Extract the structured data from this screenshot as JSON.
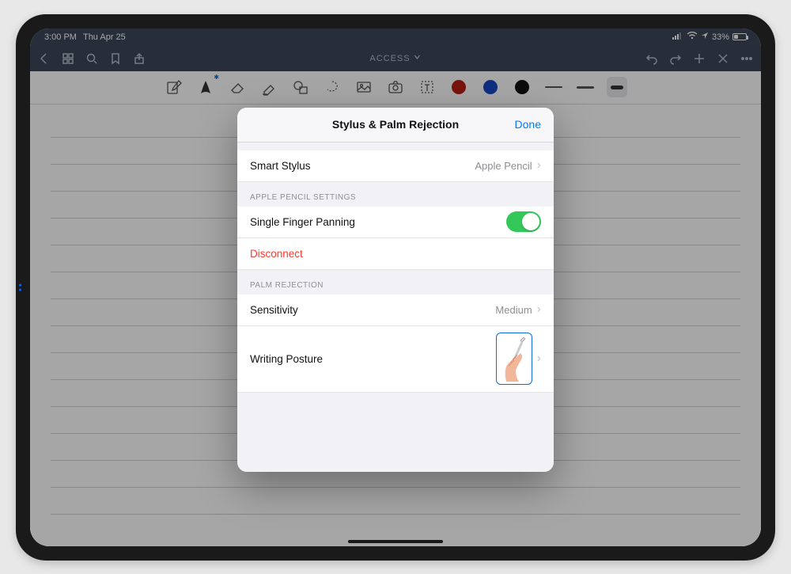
{
  "status": {
    "time": "3:00 PM",
    "date": "Thu Apr 25",
    "battery": "33%"
  },
  "nav": {
    "title": "ACCESS"
  },
  "modal": {
    "title": "Stylus & Palm Rejection",
    "done": "Done",
    "smart_stylus": {
      "label": "Smart Stylus",
      "value": "Apple Pencil"
    },
    "section_apple_pencil": "Apple Pencil Settings",
    "single_finger": "Single Finger Panning",
    "disconnect": "Disconnect",
    "section_palm": "Palm Rejection",
    "sensitivity": {
      "label": "Sensitivity",
      "value": "Medium"
    },
    "posture": {
      "label": "Writing Posture"
    }
  }
}
